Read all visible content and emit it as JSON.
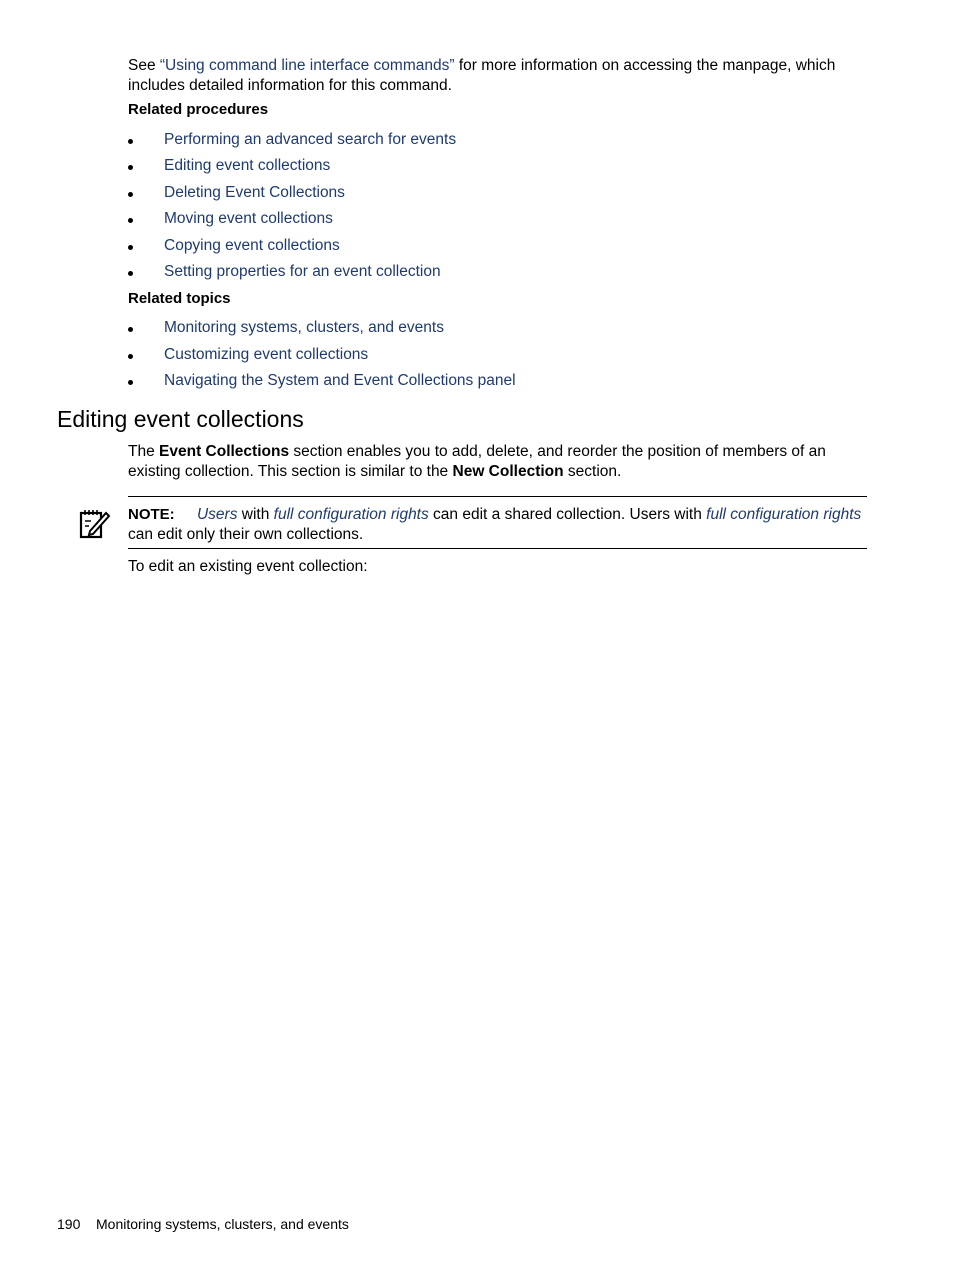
{
  "intro": {
    "prefix": "See ",
    "link": "“Using command line interface commands”",
    "suffix_line1": " for more information on accessing the manpage, which",
    "line2": "includes detailed information for this command."
  },
  "related_procedures": {
    "heading": "Related procedures",
    "items": [
      "Performing an advanced search for events",
      "Editing event collections",
      "Deleting Event Collections",
      "Moving event collections",
      "Copying event collections",
      "Setting properties for an event collection"
    ]
  },
  "related_topics": {
    "heading": "Related topics",
    "items": [
      "Monitoring systems, clusters, and events",
      "Customizing event collections",
      "Navigating the System and Event Collections panel"
    ]
  },
  "section": {
    "title": "Editing event collections",
    "para_part1": "The ",
    "para_bold1": "Event Collections",
    "para_part2": " section enables you to add, delete, and reorder the position of members of an",
    "para_line2_part1": "existing collection. This section is similar to the ",
    "para_bold2": "New Collection",
    "para_line2_part2": " section."
  },
  "note": {
    "label": "NOTE:",
    "link1": "Users",
    "text1": " with ",
    "link2": "full configuration rights",
    "text2": " can edit a shared collection. Users with ",
    "link3": "full configuration rights",
    "line2": "can edit only their own collections."
  },
  "instruction": "To edit an existing event collection:",
  "footer": {
    "page_number": "190",
    "chapter": "Monitoring systems, clusters, and events"
  }
}
